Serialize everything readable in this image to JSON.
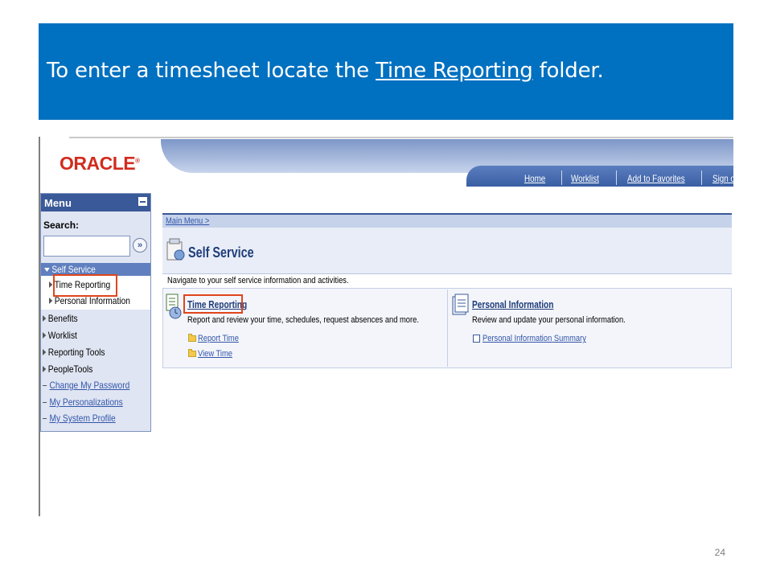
{
  "slide": {
    "title_before": "To enter a timesheet locate the ",
    "title_link": "Time Reporting",
    "title_after": " folder.",
    "number": "24"
  },
  "app": {
    "logo": "ORACLE",
    "nav": [
      "Home",
      "Worklist",
      "Add to Favorites",
      "Sign ou"
    ]
  },
  "menu": {
    "title": "Menu",
    "search_label": "Search:",
    "search_value": "",
    "items": [
      {
        "label": "Self Service"
      },
      {
        "label": "Time Reporting"
      },
      {
        "label": "Personal Information"
      },
      {
        "label": "Benefits"
      },
      {
        "label": "Worklist"
      },
      {
        "label": "Reporting Tools"
      },
      {
        "label": "PeopleTools"
      },
      {
        "label": "Change My Password"
      },
      {
        "label": "My Personalizations"
      },
      {
        "label": "My System Profile"
      }
    ]
  },
  "main": {
    "breadcrumb": "Main Menu >",
    "page_title": "Self Service",
    "description": "Navigate to your self service information and activities.",
    "sections": [
      {
        "title": "Time Reporting",
        "description": "Report and review your time, schedules, request absences and more.",
        "links": [
          "Report Time",
          "View Time"
        ]
      },
      {
        "title": "Personal Information",
        "description": "Review and update your personal information.",
        "links": [
          "Personal Information Summary"
        ]
      }
    ]
  },
  "colors": {
    "banner": "#0070c0",
    "menu_header": "#3a5998",
    "highlight": "#e0451c",
    "link": "#3355aa"
  }
}
